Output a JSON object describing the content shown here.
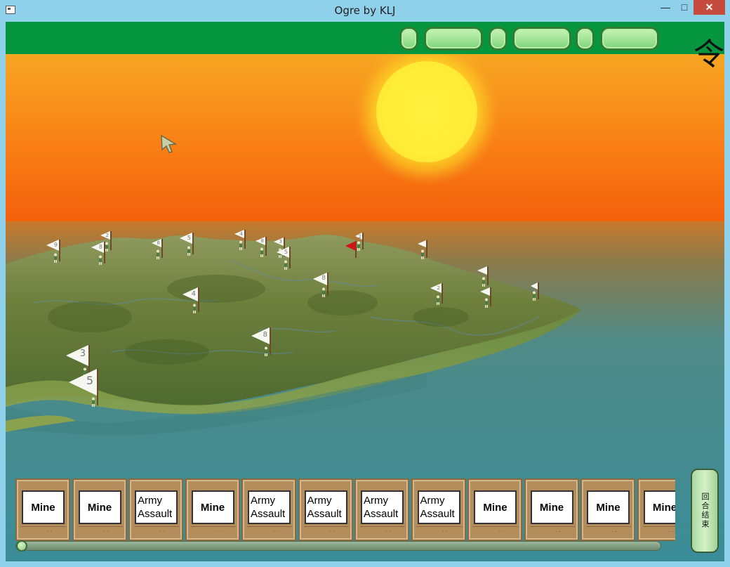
{
  "window": {
    "title": "Ogre by KLJ",
    "minimize_glyph": "—",
    "maximize_glyph": "□",
    "close_glyph": "✕"
  },
  "hud": {
    "logo_glyph": "令",
    "pills": [
      "",
      "",
      "",
      "",
      "",
      ""
    ]
  },
  "map": {
    "flags": [
      {
        "num": "9"
      },
      {
        "num": "2"
      },
      {
        "num": "8"
      },
      {
        "num": "6"
      },
      {
        "num": "5"
      },
      {
        "num": "4"
      },
      {
        "num": "8"
      },
      {
        "num": "3"
      },
      {
        "num": "5"
      },
      {
        "num": "8"
      },
      {
        "num": "2"
      }
    ]
  },
  "cards": [
    {
      "label": "Mine",
      "type": "mine"
    },
    {
      "label": "Mine",
      "type": "mine"
    },
    {
      "label": "Army\nAssault",
      "type": "assault"
    },
    {
      "label": "Mine",
      "type": "mine"
    },
    {
      "label": "Army\nAssault",
      "type": "assault"
    },
    {
      "label": "Army\nAssault",
      "type": "assault"
    },
    {
      "label": "Army\nAssault",
      "type": "assault"
    },
    {
      "label": "Army\nAssault",
      "type": "assault"
    },
    {
      "label": "Mine",
      "type": "mine"
    },
    {
      "label": "Mine",
      "type": "mine"
    },
    {
      "label": "Mine",
      "type": "mine"
    },
    {
      "label": "Mine",
      "type": "mine"
    }
  ],
  "card_scroll": {
    "position": 0.0
  },
  "end_turn_label": "回合结束",
  "colors": {
    "hud_green": "#05963f",
    "sky_top": "#f99a1c",
    "sea": "#3d8a94",
    "card_frame": "#b48d5d",
    "enemy_flag": "#d21414"
  }
}
